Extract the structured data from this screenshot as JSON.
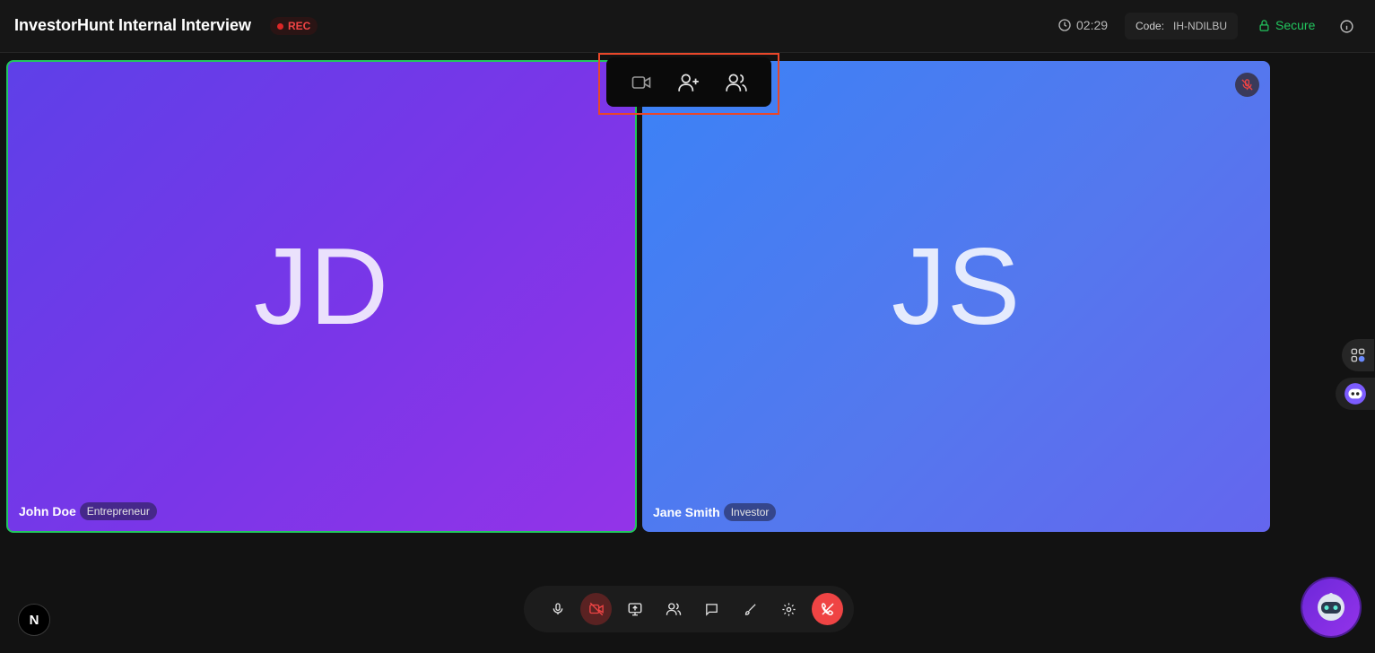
{
  "header": {
    "title": "InvestorHunt Internal Interview",
    "rec_label": "REC",
    "timer": "02:29",
    "code_label": "Code:",
    "code_value": "IH-NDILBU",
    "secure_label": "Secure"
  },
  "participants": [
    {
      "initials": "JD",
      "name": "John Doe",
      "role": "Entrepreneur",
      "active_speaker": true,
      "muted": false
    },
    {
      "initials": "JS",
      "name": "Jane Smith",
      "role": "Investor",
      "active_speaker": false,
      "muted": true
    }
  ],
  "floating_toolbar": {
    "items": [
      "video-icon",
      "add-user-icon",
      "participants-icon"
    ]
  },
  "controls": {
    "items": [
      "microphone-icon",
      "camera-off-icon",
      "screen-share-icon",
      "participants-icon",
      "chat-icon",
      "whiteboard-icon",
      "settings-icon",
      "end-call-icon"
    ]
  },
  "logo_letter": "N",
  "colors": {
    "accent_green": "#22c55e",
    "rec_red": "#ef4444",
    "highlight_border": "#e8472a",
    "end_call": "#ef4444"
  }
}
